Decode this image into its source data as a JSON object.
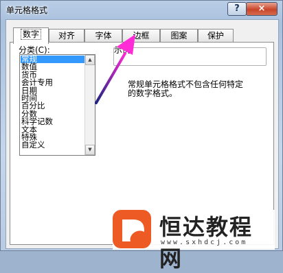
{
  "window": {
    "title": "单元格格式",
    "help": "?",
    "close": "×"
  },
  "tabs": [
    {
      "label": "数字",
      "active": true
    },
    {
      "label": "对齐",
      "active": false
    },
    {
      "label": "字体",
      "active": false
    },
    {
      "label": "边框",
      "active": false
    },
    {
      "label": "图案",
      "active": false
    },
    {
      "label": "保护",
      "active": false
    }
  ],
  "category": {
    "label": "分类(C):",
    "items": [
      "常规",
      "数值",
      "货币",
      "会计专用",
      "日期",
      "时间",
      "百分比",
      "分数",
      "科学记数",
      "文本",
      "特殊",
      "自定义"
    ],
    "selected": "常规"
  },
  "sample": {
    "label": "示例"
  },
  "description": {
    "line1": "常规单元格格式不包含任何特定",
    "line2": "的数字格式。"
  },
  "watermark": {
    "text": "恒达教程网",
    "url": "www.sxhdcj.com"
  },
  "colors": {
    "arrow_start": "#1a237e",
    "arrow_end": "#ff2bd6",
    "selected": "#3399ff",
    "logo": "#ee5a24"
  }
}
